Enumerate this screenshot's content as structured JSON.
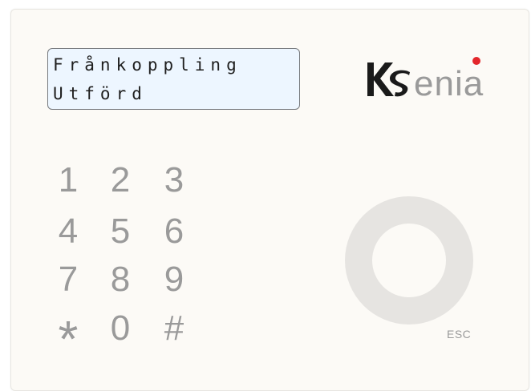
{
  "display": {
    "line1": "Frånkoppling",
    "line2": "Utförd"
  },
  "brand": {
    "logo_text": "Ksenia",
    "accent_color": "#e3262b",
    "dark_color": "#1a1a1a",
    "gray_color": "#9a9a9a"
  },
  "keypad": {
    "keys": [
      "1",
      "2",
      "3",
      "4",
      "5",
      "6",
      "7",
      "8",
      "9",
      "*",
      "0",
      "#"
    ]
  },
  "esc_button": {
    "label": "ESC"
  },
  "colors": {
    "panel_bg": "#fcfaf6",
    "lcd_bg": "#edf6ff",
    "key_text": "#9a9a9a",
    "ring": "#e6e4e1"
  }
}
